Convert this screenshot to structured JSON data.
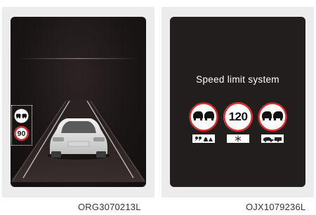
{
  "left_figure": {
    "speed_limit_value": "90",
    "caption": "ORG3070213L"
  },
  "right_figure": {
    "title": "Speed limit system",
    "speed_limit_value": "120",
    "caption": "OJX1079236L"
  },
  "icons": {
    "no_overtaking": "no-overtaking-sign-icon",
    "speed_limit": "speed-limit-sign-icon",
    "rain_condition": "rain-condition-icon",
    "snow_condition": "snowflake-icon",
    "trailer_condition": "car-trailer-icon",
    "vehicle": "vehicle-rear-icon"
  },
  "colors": {
    "sign_red": "#d82a2a",
    "sign_white": "#ffffff",
    "screen_bg": "#231e1e",
    "panel_bg": "#ececec"
  }
}
